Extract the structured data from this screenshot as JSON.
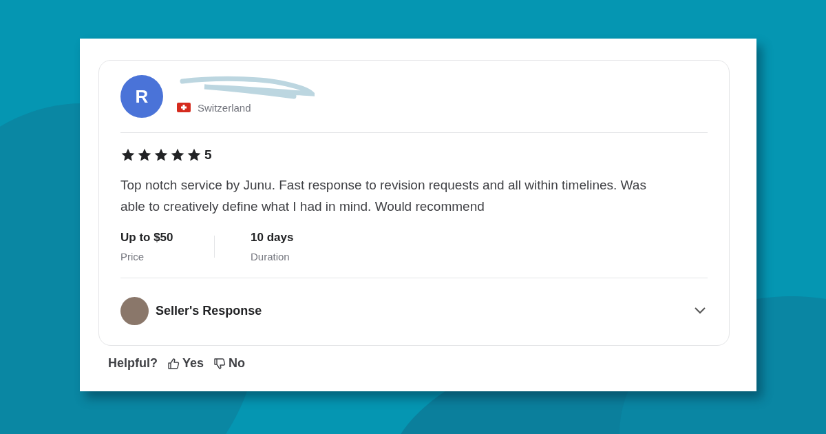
{
  "review": {
    "avatar_letter": "R",
    "country": "Switzerland",
    "stars": 5,
    "rating": "5",
    "text": "Top notch service by Junu. Fast response to revision requests and all within timelines. Was able to creatively define what I had in mind. Would recommend",
    "facts": [
      {
        "value": "Up to $50",
        "label": "Price"
      },
      {
        "value": "10 days",
        "label": "Duration"
      }
    ],
    "seller_response": {
      "label": "Seller's Response",
      "expanded": false
    }
  },
  "helpful": {
    "label": "Helpful?",
    "buttons": [
      {
        "kind": "up",
        "label": "Yes"
      },
      {
        "kind": "down",
        "label": "No"
      }
    ]
  }
}
